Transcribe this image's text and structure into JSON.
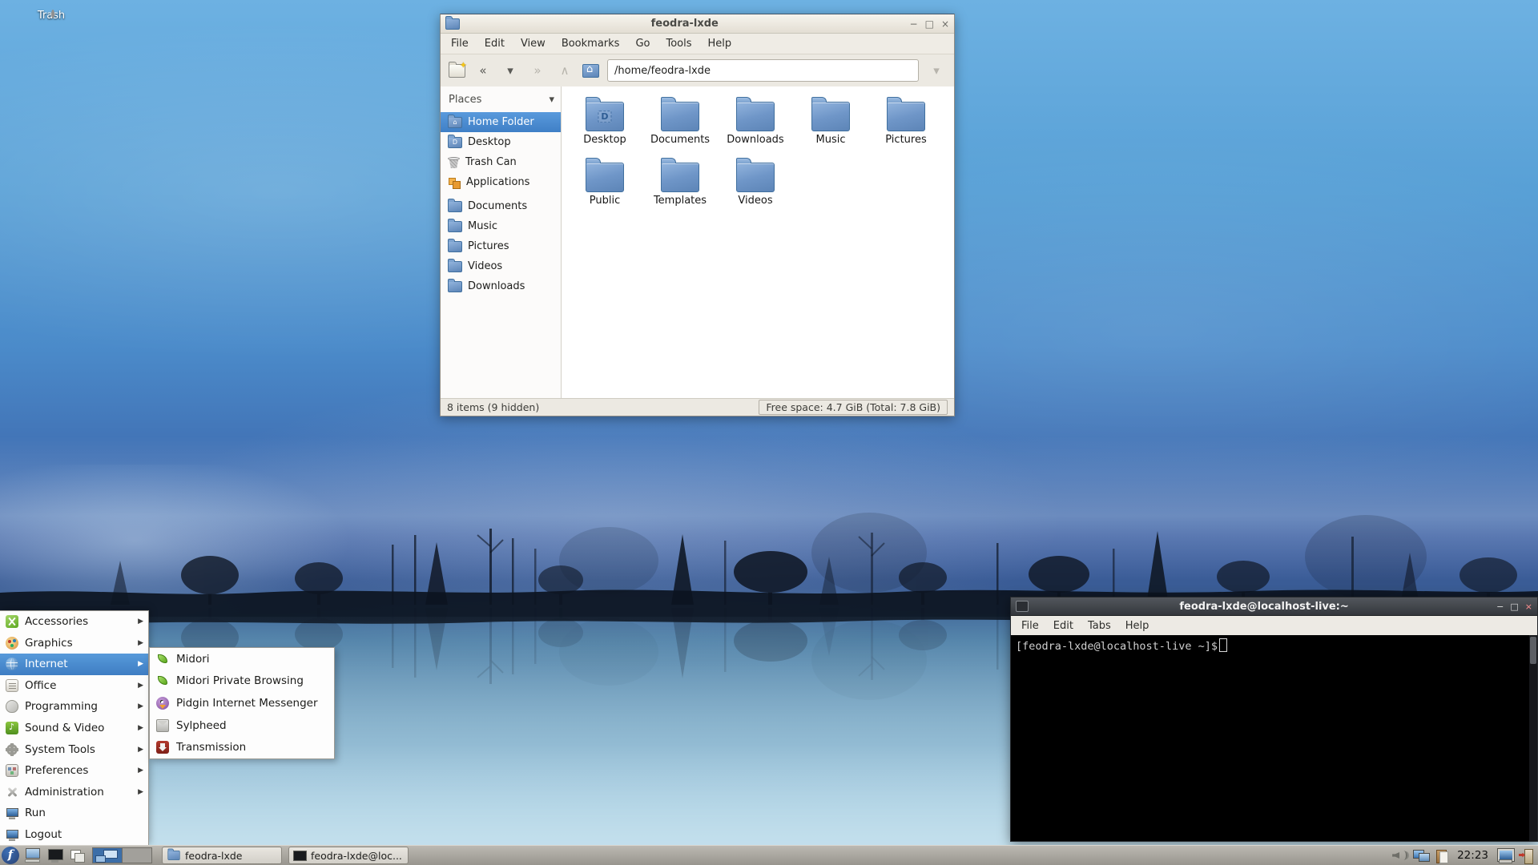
{
  "desktop_icons": {
    "trash_label": "Trash"
  },
  "file_manager": {
    "title": "feodra-lxde",
    "controls": {
      "minimize": "−",
      "maximize": "□",
      "close": "×"
    },
    "menu_items": [
      "File",
      "Edit",
      "View",
      "Bookmarks",
      "Go",
      "Tools",
      "Help"
    ],
    "toolbar": {
      "path_value": "/home/feodra-lxde",
      "icons": {
        "back": "«",
        "history": "▾",
        "forward": "»",
        "up": "∧",
        "go": "▾"
      }
    },
    "sidebar": {
      "header": "Places",
      "collapse_icon": "▾",
      "items": [
        {
          "label": "Home Folder"
        },
        {
          "label": "Desktop"
        },
        {
          "label": "Trash Can"
        },
        {
          "label": "Applications"
        },
        {
          "label": "Documents"
        },
        {
          "label": "Music"
        },
        {
          "label": "Pictures"
        },
        {
          "label": "Videos"
        },
        {
          "label": "Downloads"
        }
      ]
    },
    "folders": [
      {
        "name": "Desktop"
      },
      {
        "name": "Documents"
      },
      {
        "name": "Downloads"
      },
      {
        "name": "Music"
      },
      {
        "name": "Pictures"
      },
      {
        "name": "Public"
      },
      {
        "name": "Templates"
      },
      {
        "name": "Videos"
      }
    ],
    "desktop_overlay_mark": "D",
    "statusbar": {
      "left": "8 items (9 hidden)",
      "right": "Free space: 4.7 GiB (Total: 7.8 GiB)"
    }
  },
  "terminal": {
    "title": "feodra-lxde@localhost-live:~",
    "controls": {
      "minimize": "−",
      "maximize": "□",
      "close": "×"
    },
    "menu_items": [
      "File",
      "Edit",
      "Tabs",
      "Help"
    ],
    "prompt": "[feodra-lxde@localhost-live ~]$"
  },
  "start_menu": {
    "items": [
      {
        "label": "Accessories",
        "arrow": "▶"
      },
      {
        "label": "Graphics",
        "arrow": "▶"
      },
      {
        "label": "Internet",
        "arrow": "▶"
      },
      {
        "label": "Office",
        "arrow": "▶"
      },
      {
        "label": "Programming",
        "arrow": "▶"
      },
      {
        "label": "Sound & Video",
        "arrow": "▶"
      },
      {
        "label": "System Tools",
        "arrow": "▶"
      },
      {
        "label": "Preferences",
        "arrow": "▶"
      },
      {
        "label": "Administration",
        "arrow": "▶"
      },
      {
        "label": "Run",
        "arrow": ""
      },
      {
        "label": "Logout",
        "arrow": ""
      }
    ],
    "submenu": {
      "items": [
        {
          "label": "Midori"
        },
        {
          "label": "Midori Private Browsing"
        },
        {
          "label": "Pidgin Internet Messenger"
        },
        {
          "label": "Sylpheed"
        },
        {
          "label": "Transmission"
        }
      ]
    }
  },
  "taskbar": {
    "tasks": [
      {
        "label": "feodra-lxde"
      },
      {
        "label": "feodra-lxde@loc..."
      }
    ],
    "clock": "22:23"
  }
}
